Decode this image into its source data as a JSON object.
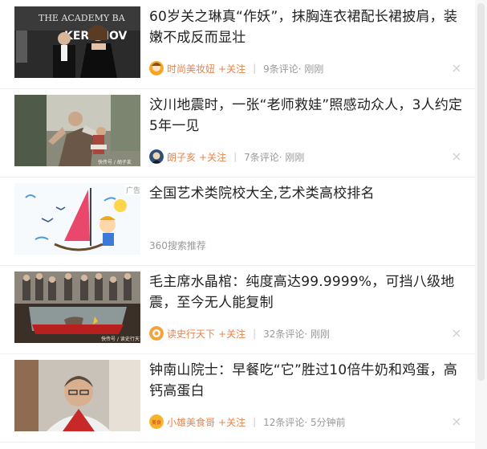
{
  "feed": {
    "items": [
      {
        "title": "60岁关之琳真“作妖”，抹胸连衣裙配长裙披肩，装嫩不成反而显壮",
        "thumb_text": "THE ACADEMY BA",
        "thumb_text2": "KERAMOV",
        "author": "时尚美妆妞",
        "follow": "+关注",
        "comments": "9条评论",
        "time": "· 刚刚"
      },
      {
        "title": "汶川地震时，一张“老师救娃”照感动众人，3人约定5年一见",
        "thumb_caption": "快传号 / 胡子亥",
        "author": "朗子亥",
        "follow": "+关注",
        "comments": "7条评论",
        "time": "· 刚刚"
      },
      {
        "title": "全国艺术类院校大全,艺术类高校排名",
        "thumb_badge": "广告",
        "source": "360搜索推荐"
      },
      {
        "title": "毛主席水晶棺：纯度高达99.9999%，可挡八级地震，至今无人能复制",
        "thumb_caption": "快传号 / 读史行天下",
        "author": "读史行天下",
        "follow": "+关注",
        "comments": "32条评论",
        "time": "· 刚刚"
      },
      {
        "title": "钟南山院士：早餐吃“它”胜过10倍牛奶和鸡蛋，高钙高蛋白",
        "avatar_text": "美食",
        "author": "小雄美食哥",
        "follow": "+关注",
        "comments": "12条评论",
        "time": "· 5分钟前"
      }
    ],
    "separator": "|"
  },
  "icons": {
    "close": "close-icon"
  },
  "colors": {
    "accent": "#e8834a",
    "title": "#222222",
    "meta": "#999999"
  }
}
